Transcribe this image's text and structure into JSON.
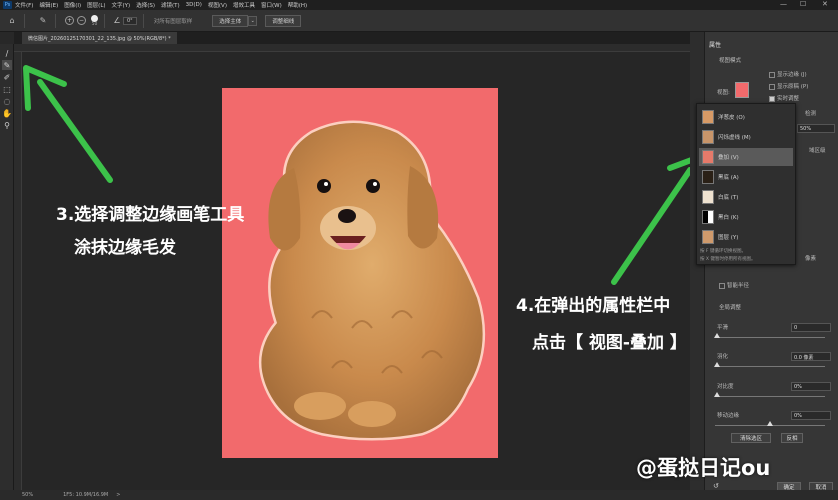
{
  "app": {
    "logo": "Ps"
  },
  "menu": [
    "文件(F)",
    "编辑(E)",
    "图像(I)",
    "图层(L)",
    "文字(Y)",
    "选择(S)",
    "滤镜(T)",
    "3D(D)",
    "视图(V)",
    "增效工具",
    "窗口(W)",
    "帮助(H)"
  ],
  "window_controls": {
    "minimize": "—",
    "maximize": "☐",
    "close": "✕"
  },
  "options": {
    "brush_size": "50",
    "angle": "0°",
    "sample_all_layers": "对所有图层取样",
    "select_subject": "选择主体",
    "refine_hair": "调整细线"
  },
  "document_tab": "微信图片_20260125170301_22_135.jpg @ 50%(RGB/8*) *",
  "annotations": {
    "step3_line1": "3.选择调整边缘画笔工具",
    "step3_line2": "涂抹边缘毛发",
    "step4_line1": "4.在弹出的属性栏中",
    "step4_line2": "点击【 视图-叠加 】"
  },
  "status": {
    "zoom": "50%",
    "doc_info": "1F5: 10.9M/16.9M",
    "arrow": ">"
  },
  "panel": {
    "title": "属性",
    "view_mode_label": "视图模式",
    "view_label": "视图:",
    "show_edge": "显示边缘 (J)",
    "show_original": "显示原稿 (P)",
    "realtime": "实时调整",
    "edge_detect_partial": "检测",
    "radius_value": "50%",
    "area_partial": "域区级",
    "smart_radius": "智能半径",
    "global_label": "全局调整",
    "smooth": "平滑",
    "smooth_value": "0",
    "feather": "羽化",
    "feather_value": "0.0 像素",
    "contrast": "对比度",
    "contrast_value": "0%",
    "shift_edge": "移动边缘",
    "shift_edge_value": "0%",
    "clear_selection": "清除选区",
    "invert": "反相",
    "ok": "确定",
    "cancel": "取消",
    "decontaminate_partial": "像素"
  },
  "view_menu": {
    "items": [
      "洋葱皮 (O)",
      "闪烁虚线 (M)",
      "叠加 (V)",
      "黑底 (A)",
      "白底 (T)",
      "黑白 (K)",
      "图层 (Y)"
    ],
    "selected_index": 2,
    "hint1": "按 F 键循环切换视图。",
    "hint2": "按 X 键暂时停用所有视图。"
  },
  "watermark": "@蛋挞日记ou",
  "colors": {
    "photo_bg": "#f26a6c",
    "arrow_green": "#3cc24a",
    "panel_bg": "#363636"
  }
}
